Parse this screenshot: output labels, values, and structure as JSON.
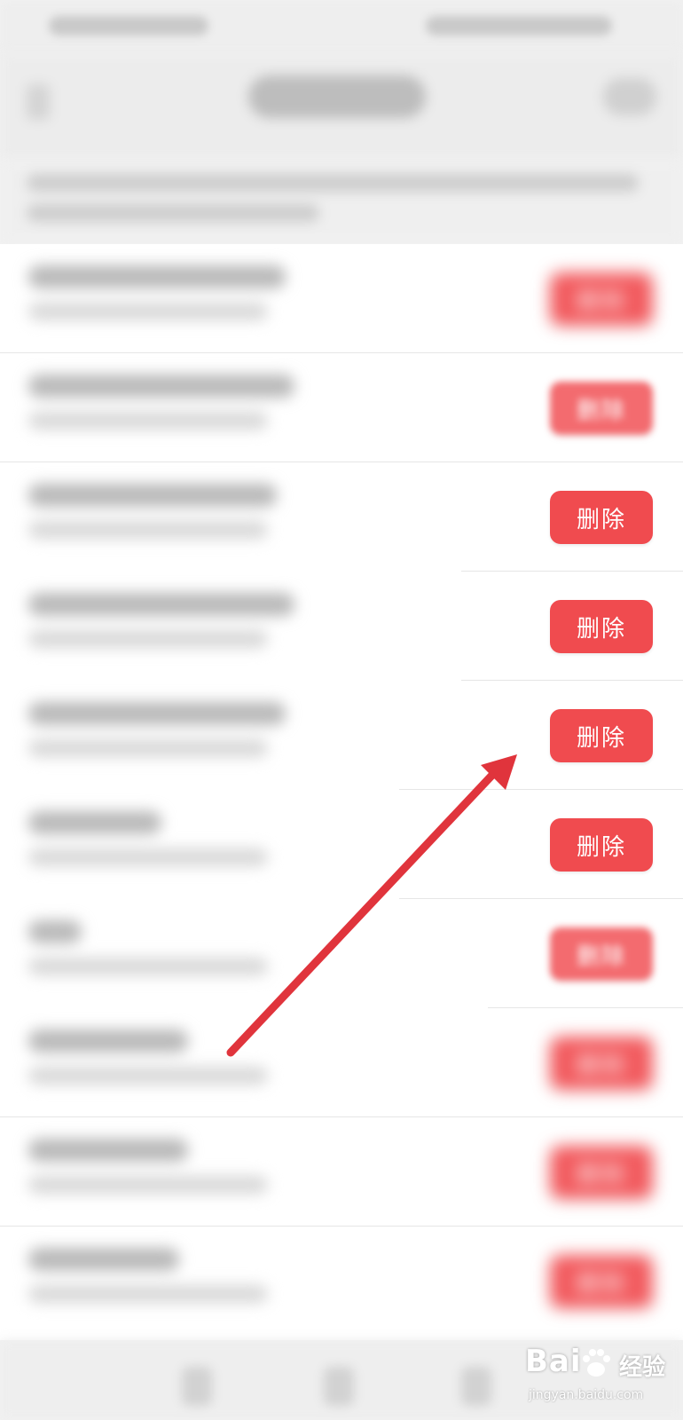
{
  "list": {
    "delete_label": "删除",
    "rows": [
      {
        "button_label": "删除",
        "clarity": "blurred"
      },
      {
        "button_label": "删除",
        "clarity": "faded"
      },
      {
        "button_label": "删除",
        "clarity": "clear"
      },
      {
        "button_label": "删除",
        "clarity": "clear"
      },
      {
        "button_label": "删除",
        "clarity": "clear"
      },
      {
        "button_label": "删除",
        "clarity": "clear"
      },
      {
        "button_label": "删除",
        "clarity": "faded"
      },
      {
        "button_label": "删除",
        "clarity": "blurred"
      },
      {
        "button_label": "删除",
        "clarity": "blurred"
      },
      {
        "button_label": "删除",
        "clarity": "blurred"
      }
    ]
  },
  "annotation": {
    "icon": "red-arrow-icon",
    "color": "#e0343c",
    "points_to": "delete-button (row 5)"
  },
  "colors": {
    "delete_button": "#f04b4f",
    "background": "#ffffff",
    "header_background": "#eeeeee"
  },
  "watermark": {
    "brand": "Bai",
    "brand_suffix": "经验",
    "url": "jingyan.baidu.com"
  }
}
